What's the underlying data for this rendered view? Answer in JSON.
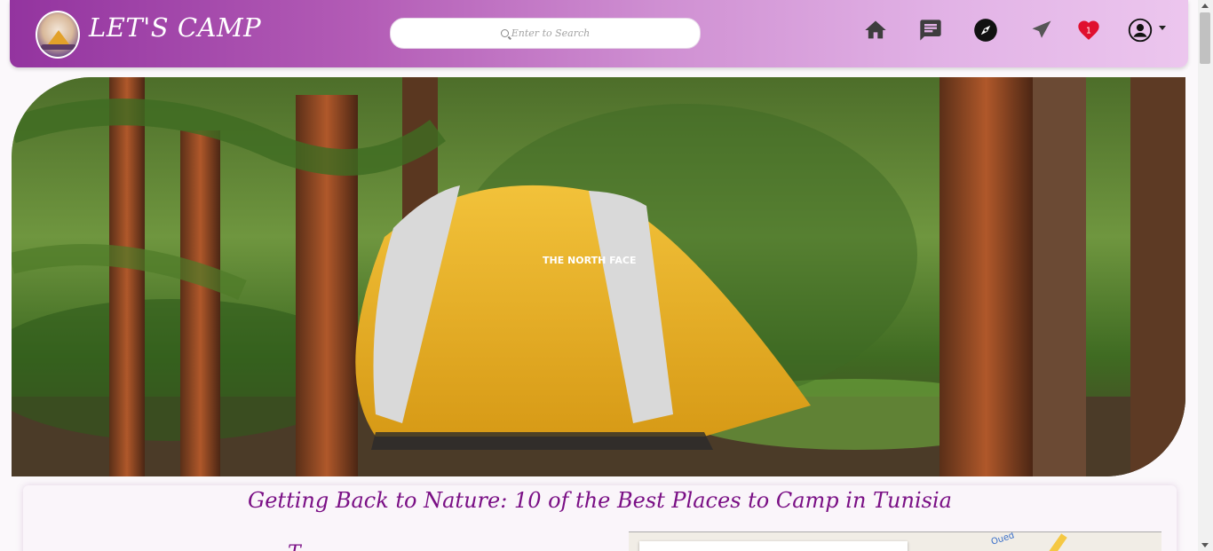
{
  "header": {
    "brand": "LET'S CAMP",
    "search_placeholder": "Enter to Search",
    "notifications_count": "1"
  },
  "nav_icons": [
    "home-icon",
    "chat-icon",
    "compass-icon",
    "send-icon",
    "heart-icon",
    "user-icon"
  ],
  "hero": {
    "tent_brand": "THE NORTH FACE"
  },
  "article": {
    "title": "Getting Back to Nature: 10 of the Best Places to Camp in Tunisia",
    "map_label": "Oued"
  },
  "colors": {
    "accent": "#7a0f85",
    "nav_gradient_start": "#93349f",
    "nav_gradient_end": "#ecc6ee",
    "heart": "#e0102f"
  }
}
